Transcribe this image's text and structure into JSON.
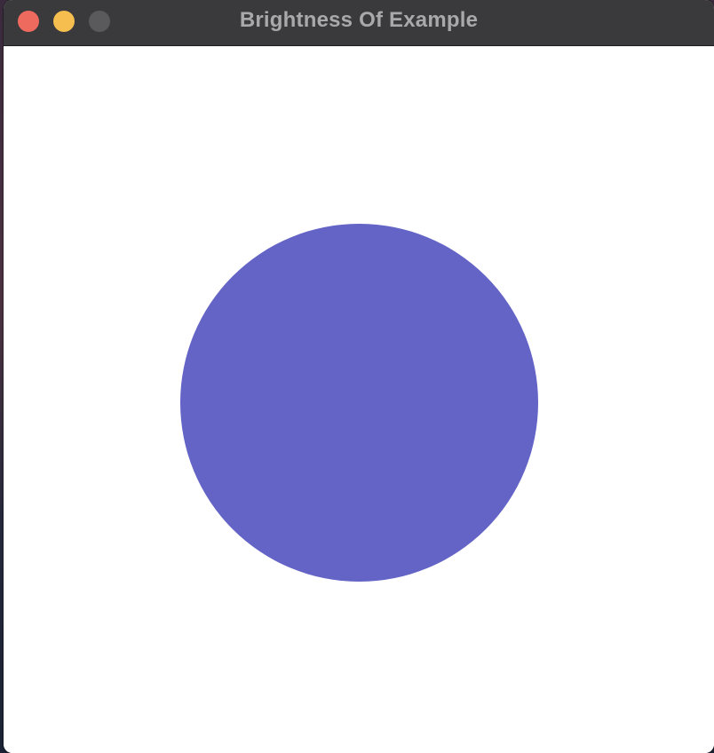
{
  "window": {
    "title": "Brightness Of Example"
  },
  "traffic_lights": {
    "close_color": "#ee6a5f",
    "minimize_color": "#f5be4f",
    "zoom_color": "#5a595c"
  },
  "canvas": {
    "background_color": "#ffffff",
    "shape": "circle",
    "shape_color": "#6364c6"
  }
}
